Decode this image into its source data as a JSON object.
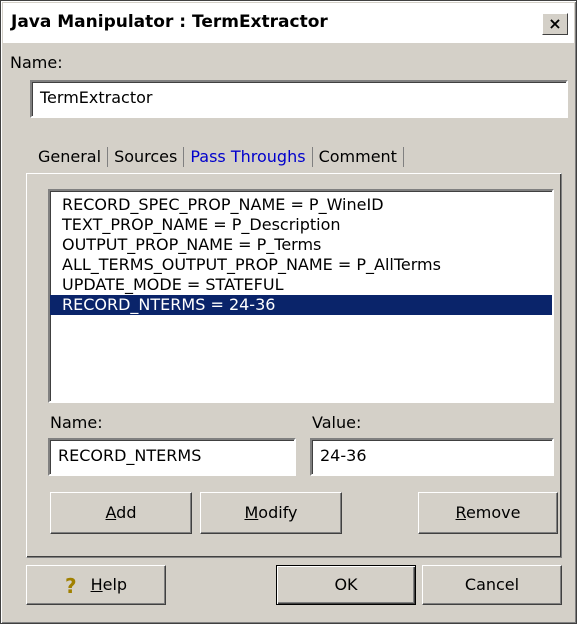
{
  "window": {
    "title": "Java Manipulator : TermExtractor",
    "close_label": "×"
  },
  "name_field": {
    "label": "Name:",
    "value": "TermExtractor"
  },
  "tabs": [
    {
      "label": "General"
    },
    {
      "label": "Sources"
    },
    {
      "label": "Pass Throughs",
      "active": true
    },
    {
      "label": "Comment"
    }
  ],
  "pass_throughs": {
    "items": [
      "RECORD_SPEC_PROP_NAME = P_WineID",
      "TEXT_PROP_NAME = P_Description",
      "OUTPUT_PROP_NAME = P_Terms",
      "ALL_TERMS_OUTPUT_PROP_NAME = P_AllTerms",
      "UPDATE_MODE = STATEFUL",
      "RECORD_NTERMS = 24-36"
    ],
    "selected_index": 5,
    "name_label": "Name:",
    "name_value": "RECORD_NTERMS",
    "value_label": "Value:",
    "value_value": "24-36",
    "add_button": {
      "mnemonic": "A",
      "rest": "dd"
    },
    "modify_button": {
      "mnemonic": "M",
      "rest": "odify"
    },
    "remove_button": {
      "mnemonic": "R",
      "rest": "emove"
    }
  },
  "footer": {
    "help_icon": "?",
    "help_button": {
      "mnemonic": "H",
      "rest": "elp"
    },
    "ok_label": "OK",
    "cancel_label": "Cancel"
  }
}
